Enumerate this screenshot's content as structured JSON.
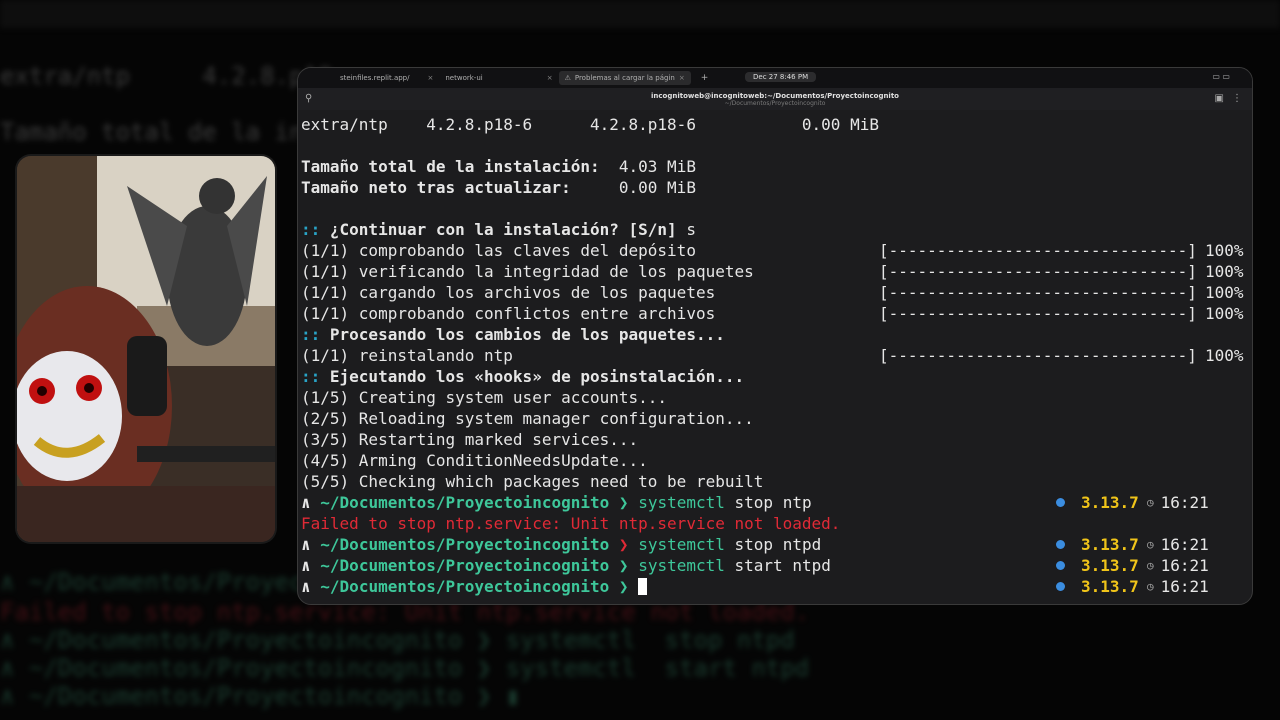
{
  "browser": {
    "tabs": [
      {
        "label": "steinfiles.replit.app/",
        "close": "×"
      },
      {
        "label": "network-ui",
        "close": "×"
      },
      {
        "label": "Problemas al cargar la págin",
        "close": "×"
      }
    ],
    "new_tab": "+",
    "clock": "Dec 27   8:46 PM"
  },
  "terminal": {
    "title": "incognitoweb@incognitoweb:~/Documentos/Proyectoincognito",
    "subtitle": "~/Documentos/Proyectoincognito",
    "lines": {
      "l0": "extra/ntp    4.2.8.p18-6      4.2.8.p18-6           0.00 MiB",
      "l1a": "Tamaño total de la instalación:",
      "l1b": "  4.03 MiB",
      "l2a": "Tamaño neto tras actualizar:",
      "l2b": "     0.00 MiB",
      "l3p": "::",
      "l3a": " ¿Continuar con la instalación? [S/n]",
      "l3b": " s",
      "l4": "(1/1) comprobando las claves del depósito",
      "l5": "(1/1) verificando la integridad de los paquetes",
      "l6": "(1/1) cargando los archivos de los paquetes",
      "l7": "(1/1) comprobando conflictos entre archivos",
      "l8p": "::",
      "l8a": " Procesando los cambios de los paquetes...",
      "l9": "(1/1) reinstalando ntp",
      "l10p": "::",
      "l10a": " Ejecutando los «hooks» de posinstalación...",
      "l11": "(1/5) Creating system user accounts...",
      "l12": "(2/5) Reloading system manager configuration...",
      "l13": "(3/5) Restarting marked services...",
      "l14": "(4/5) Arming ConditionNeedsUpdate...",
      "l15": "(5/5) Checking which packages need to be rebuilt",
      "err": "Failed to stop ntp.service: Unit ntp.service not loaded."
    },
    "progress_bar": "[-------------------------------]",
    "progress_pct": "100%",
    "prompt_arrow": "∧",
    "prompt_path": "~/Documentos/Proyectoincognito",
    "prompt_chevron": "❯",
    "commands": [
      {
        "cmd": "systemctl",
        "args": " stop ntp"
      },
      {
        "cmd": "systemctl",
        "args": " stop ntpd"
      },
      {
        "cmd": "systemctl",
        "args": " start ntpd"
      }
    ],
    "python_version": "3.13.7",
    "time": "16:21",
    "clock_icon": "◷"
  },
  "colors": {
    "accent_green": "#3ec79a",
    "error_red": "#e02a36",
    "version_yellow": "#f0c419",
    "cyan": "#29a3c6"
  }
}
